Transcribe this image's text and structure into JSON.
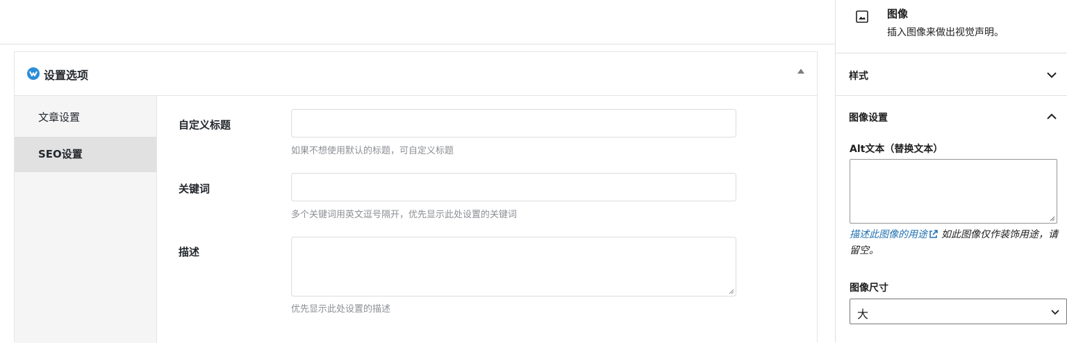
{
  "metabox": {
    "title": "设置选项",
    "tabs": [
      "文章设置",
      "SEO设置"
    ],
    "active_tab": "SEO设置",
    "fields": [
      {
        "label": "自定义标题",
        "value": "",
        "help": "如果不想使用默认的标题，可自定义标题"
      },
      {
        "label": "关键词",
        "value": "",
        "help": "多个关键词用英文逗号隔开，优先显示此处设置的关键词"
      },
      {
        "label": "描述",
        "value": "",
        "help": "优先显示此处设置的描述"
      }
    ]
  },
  "sidebar": {
    "block": {
      "icon": "image-icon",
      "title": "图像",
      "description": "插入图像来做出视觉声明。"
    },
    "panels": {
      "style": {
        "title": "样式",
        "state": "collapsed"
      },
      "image_settings": {
        "title": "图像设置",
        "state": "expanded"
      }
    },
    "alt": {
      "label": "Alt文本（替换文本）",
      "value": "",
      "help_link": "描述此图像的用途",
      "help_text": "如此图像仅作装饰用途，请留空。"
    },
    "size": {
      "label": "图像尺寸",
      "value": "大"
    }
  },
  "colors": {
    "accent": "#2271b1",
    "logo": "#2b8ed8",
    "active_tab_bg": "#e1e1e1"
  }
}
